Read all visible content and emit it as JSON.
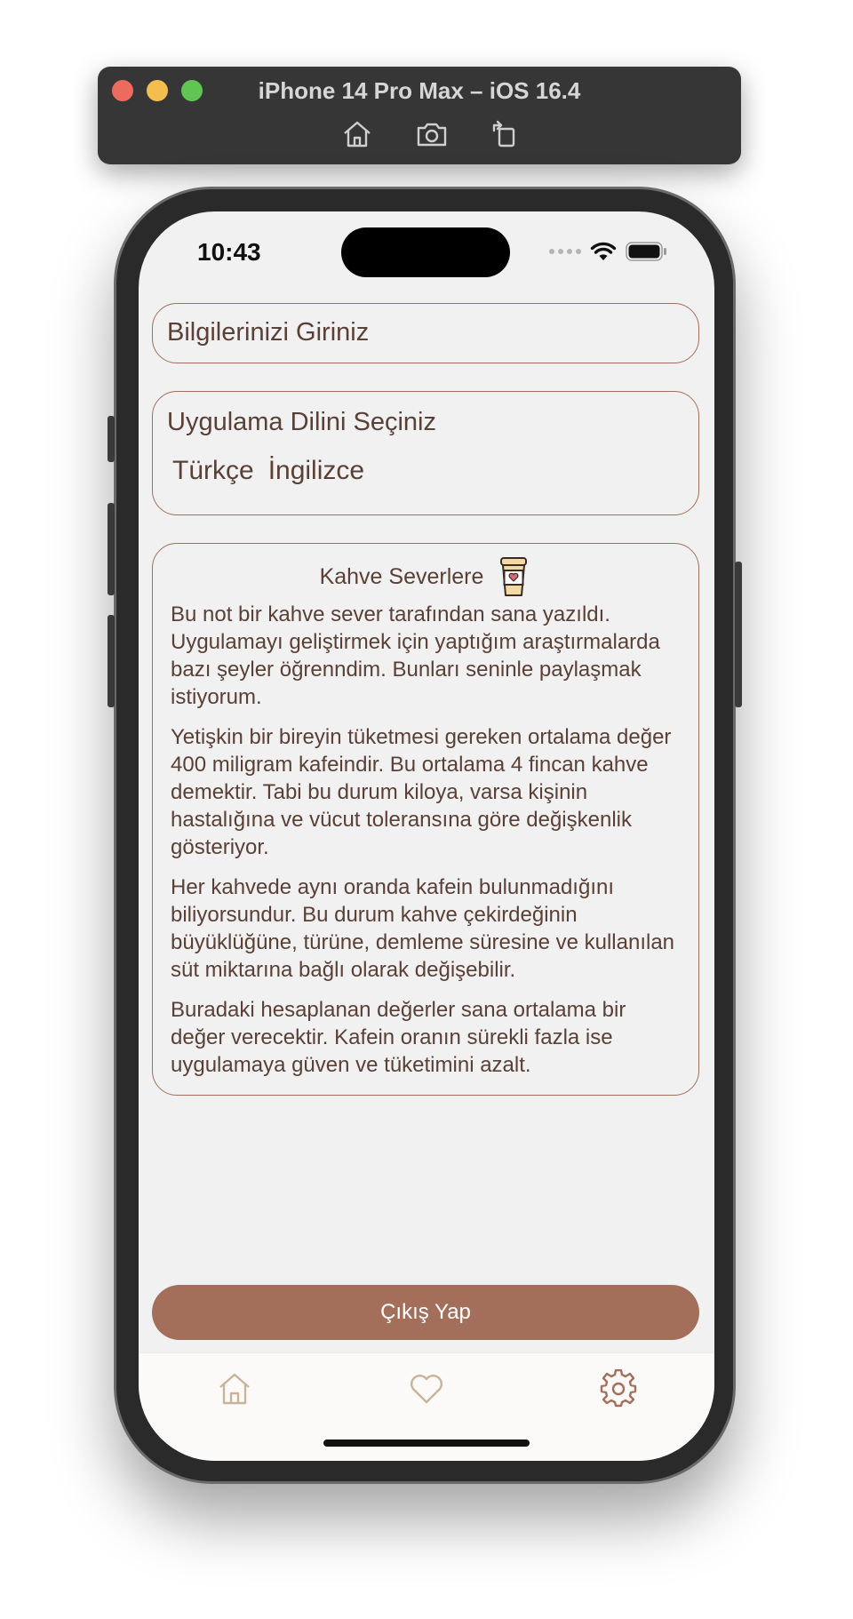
{
  "simulator": {
    "title": "iPhone 14 Pro Max – iOS 16.4",
    "buttons": [
      "home-icon",
      "screenshot-icon",
      "rotate-icon"
    ]
  },
  "status_bar": {
    "time": "10:43"
  },
  "info_card": {
    "title": "Bilgilerinizi Giriniz"
  },
  "language_card": {
    "title": "Uygulama Dilini Seçiniz",
    "options": [
      "Türkçe",
      "İngilizce"
    ]
  },
  "note_card": {
    "title": "Kahve Severlere",
    "icon": "coffee-cup-icon",
    "paragraphs": [
      "Bu not bir kahve sever tarafından sana yazıldı. Uygulamayı geliştirmek için yaptığım araştırmalarda bazı şeyler öğrenndim. Bunları seninle paylaşmak istiyorum.",
      "Yetişkin bir bireyin tüketmesi gereken ortalama değer 400 miligram kafeindir. Bu ortalama 4 fincan kahve demektir. Tabi bu durum kiloya, varsa kişinin hastalığına ve vücut toleransına göre değişkenlik gösteriyor.",
      "Her kahvede aynı oranda kafein bulunmadığını biliyorsundur. Bu durum kahve çekirdeğinin büyüklüğüne, türüne, demleme süresine ve kullanılan süt miktarına bağlı olarak değişebilir.",
      "Buradaki hesaplanan değerler sana ortalama bir değer verecektir. Kafein oranın sürekli fazla ise uygulamaya güven ve tüketimini azalt."
    ]
  },
  "logout_button": {
    "label": "Çıkış Yap"
  },
  "tab_bar": {
    "items": [
      "home-icon",
      "heart-icon",
      "gear-icon"
    ],
    "active": "gear-icon"
  },
  "colors": {
    "accent": "#a36f5b",
    "text": "#5a4036",
    "inactive_tab": "#c9b49a",
    "background": "#f1f1f1"
  }
}
